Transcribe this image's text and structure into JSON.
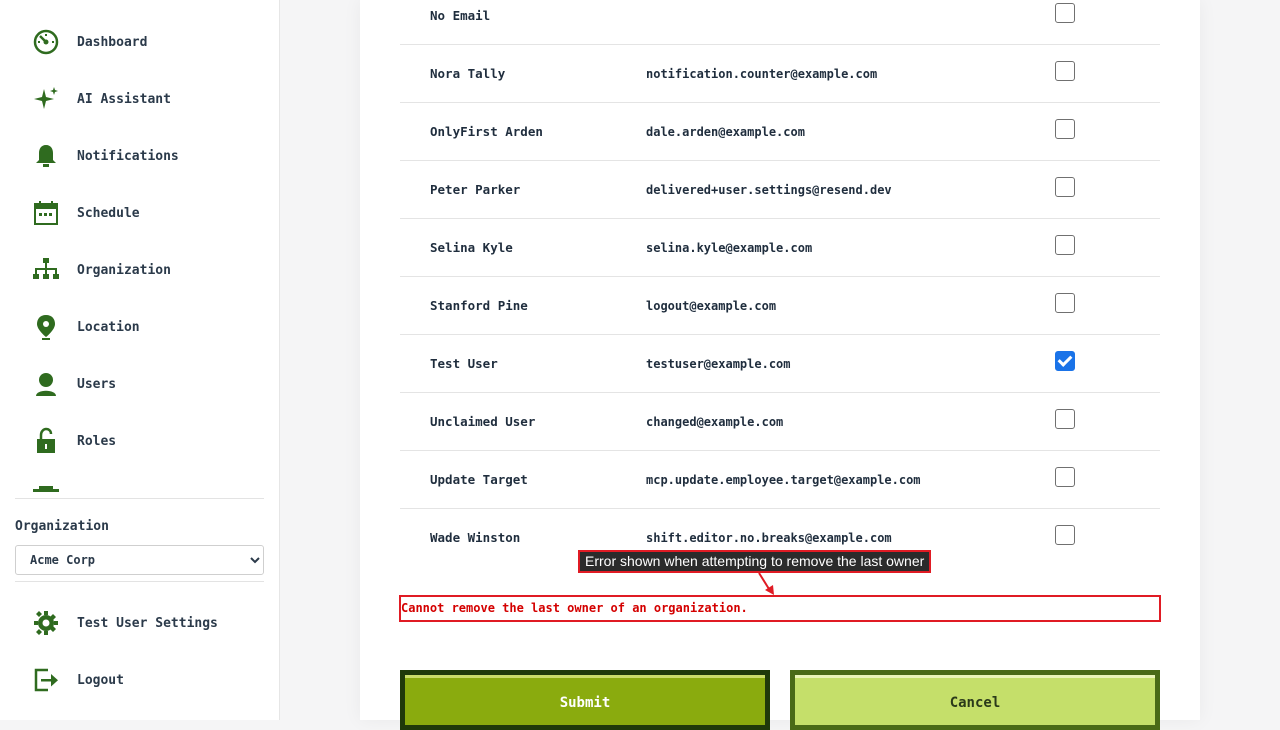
{
  "sidebar": {
    "items": [
      {
        "label": "Dashboard",
        "icon": "dashboard-icon"
      },
      {
        "label": "AI Assistant",
        "icon": "sparkle-icon"
      },
      {
        "label": "Notifications",
        "icon": "bell-icon"
      },
      {
        "label": "Schedule",
        "icon": "calendar-icon"
      },
      {
        "label": "Organization",
        "icon": "org-chart-icon"
      },
      {
        "label": "Location",
        "icon": "location-pin-icon"
      },
      {
        "label": "Users",
        "icon": "user-icon"
      },
      {
        "label": "Roles",
        "icon": "unlock-icon"
      }
    ],
    "org_label": "Organization",
    "org_selected": "Acme Corp",
    "settings_label": "Test User Settings",
    "logout_label": "Logout"
  },
  "users": [
    {
      "name": "No Email",
      "email": "",
      "checked": false
    },
    {
      "name": "Nora Tally",
      "email": "notification.counter@example.com",
      "checked": false
    },
    {
      "name": "OnlyFirst Arden",
      "email": "dale.arden@example.com",
      "checked": false
    },
    {
      "name": "Peter Parker",
      "email": "delivered+user.settings@resend.dev",
      "checked": false
    },
    {
      "name": "Selina Kyle",
      "email": "selina.kyle@example.com",
      "checked": false
    },
    {
      "name": "Stanford Pine",
      "email": "logout@example.com",
      "checked": false
    },
    {
      "name": "Test User",
      "email": "testuser@example.com",
      "checked": true
    },
    {
      "name": "Unclaimed User",
      "email": "changed@example.com",
      "checked": false
    },
    {
      "name": "Update Target",
      "email": "mcp.update.employee.target@example.com",
      "checked": false
    },
    {
      "name": "Wade Winston",
      "email": "shift.editor.no.breaks@example.com",
      "checked": false
    }
  ],
  "annotation": "Error shown when attempting to remove the last owner",
  "error_message": "Cannot remove the last owner of an organization.",
  "buttons": {
    "submit": "Submit",
    "cancel": "Cancel"
  },
  "colors": {
    "icon_green": "#2f6b1f",
    "error_red": "#d40000",
    "checkbox_blue": "#1a73e8",
    "submit_green": "#8aab0e",
    "cancel_green": "#c5df6a"
  }
}
